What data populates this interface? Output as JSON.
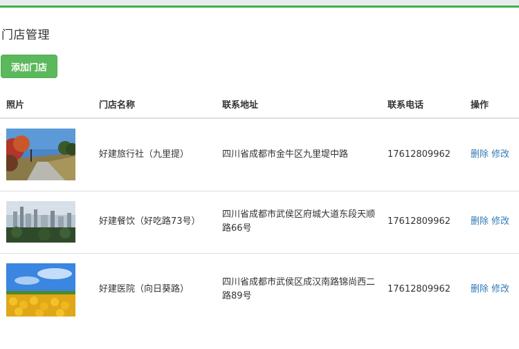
{
  "page": {
    "title": "门店管理"
  },
  "toolbar": {
    "add_label": "添加门店"
  },
  "table": {
    "headers": [
      "照片",
      "门店名称",
      "联系地址",
      "联系电话",
      "操作"
    ],
    "rows": [
      {
        "name": "好建旅行社（九里提）",
        "address": "四川省成都市金牛区九里堤中路",
        "phone": "17612809962",
        "delete": "删除",
        "edit": "修改"
      },
      {
        "name": "好建餐饮（好吃路73号）",
        "address": "四川省成都市武侯区府城大道东段天顺路66号",
        "phone": "17612809962",
        "delete": "删除",
        "edit": "修改"
      },
      {
        "name": "好建医院（向日葵路）",
        "address": "四川省成都市武侯区成汉南路锦尚西二路89号",
        "phone": "17612809962",
        "delete": "删除",
        "edit": "修改"
      }
    ]
  },
  "colors": {
    "accent": "#3fae49",
    "button": "#5cb85c",
    "link": "#337ab7"
  }
}
